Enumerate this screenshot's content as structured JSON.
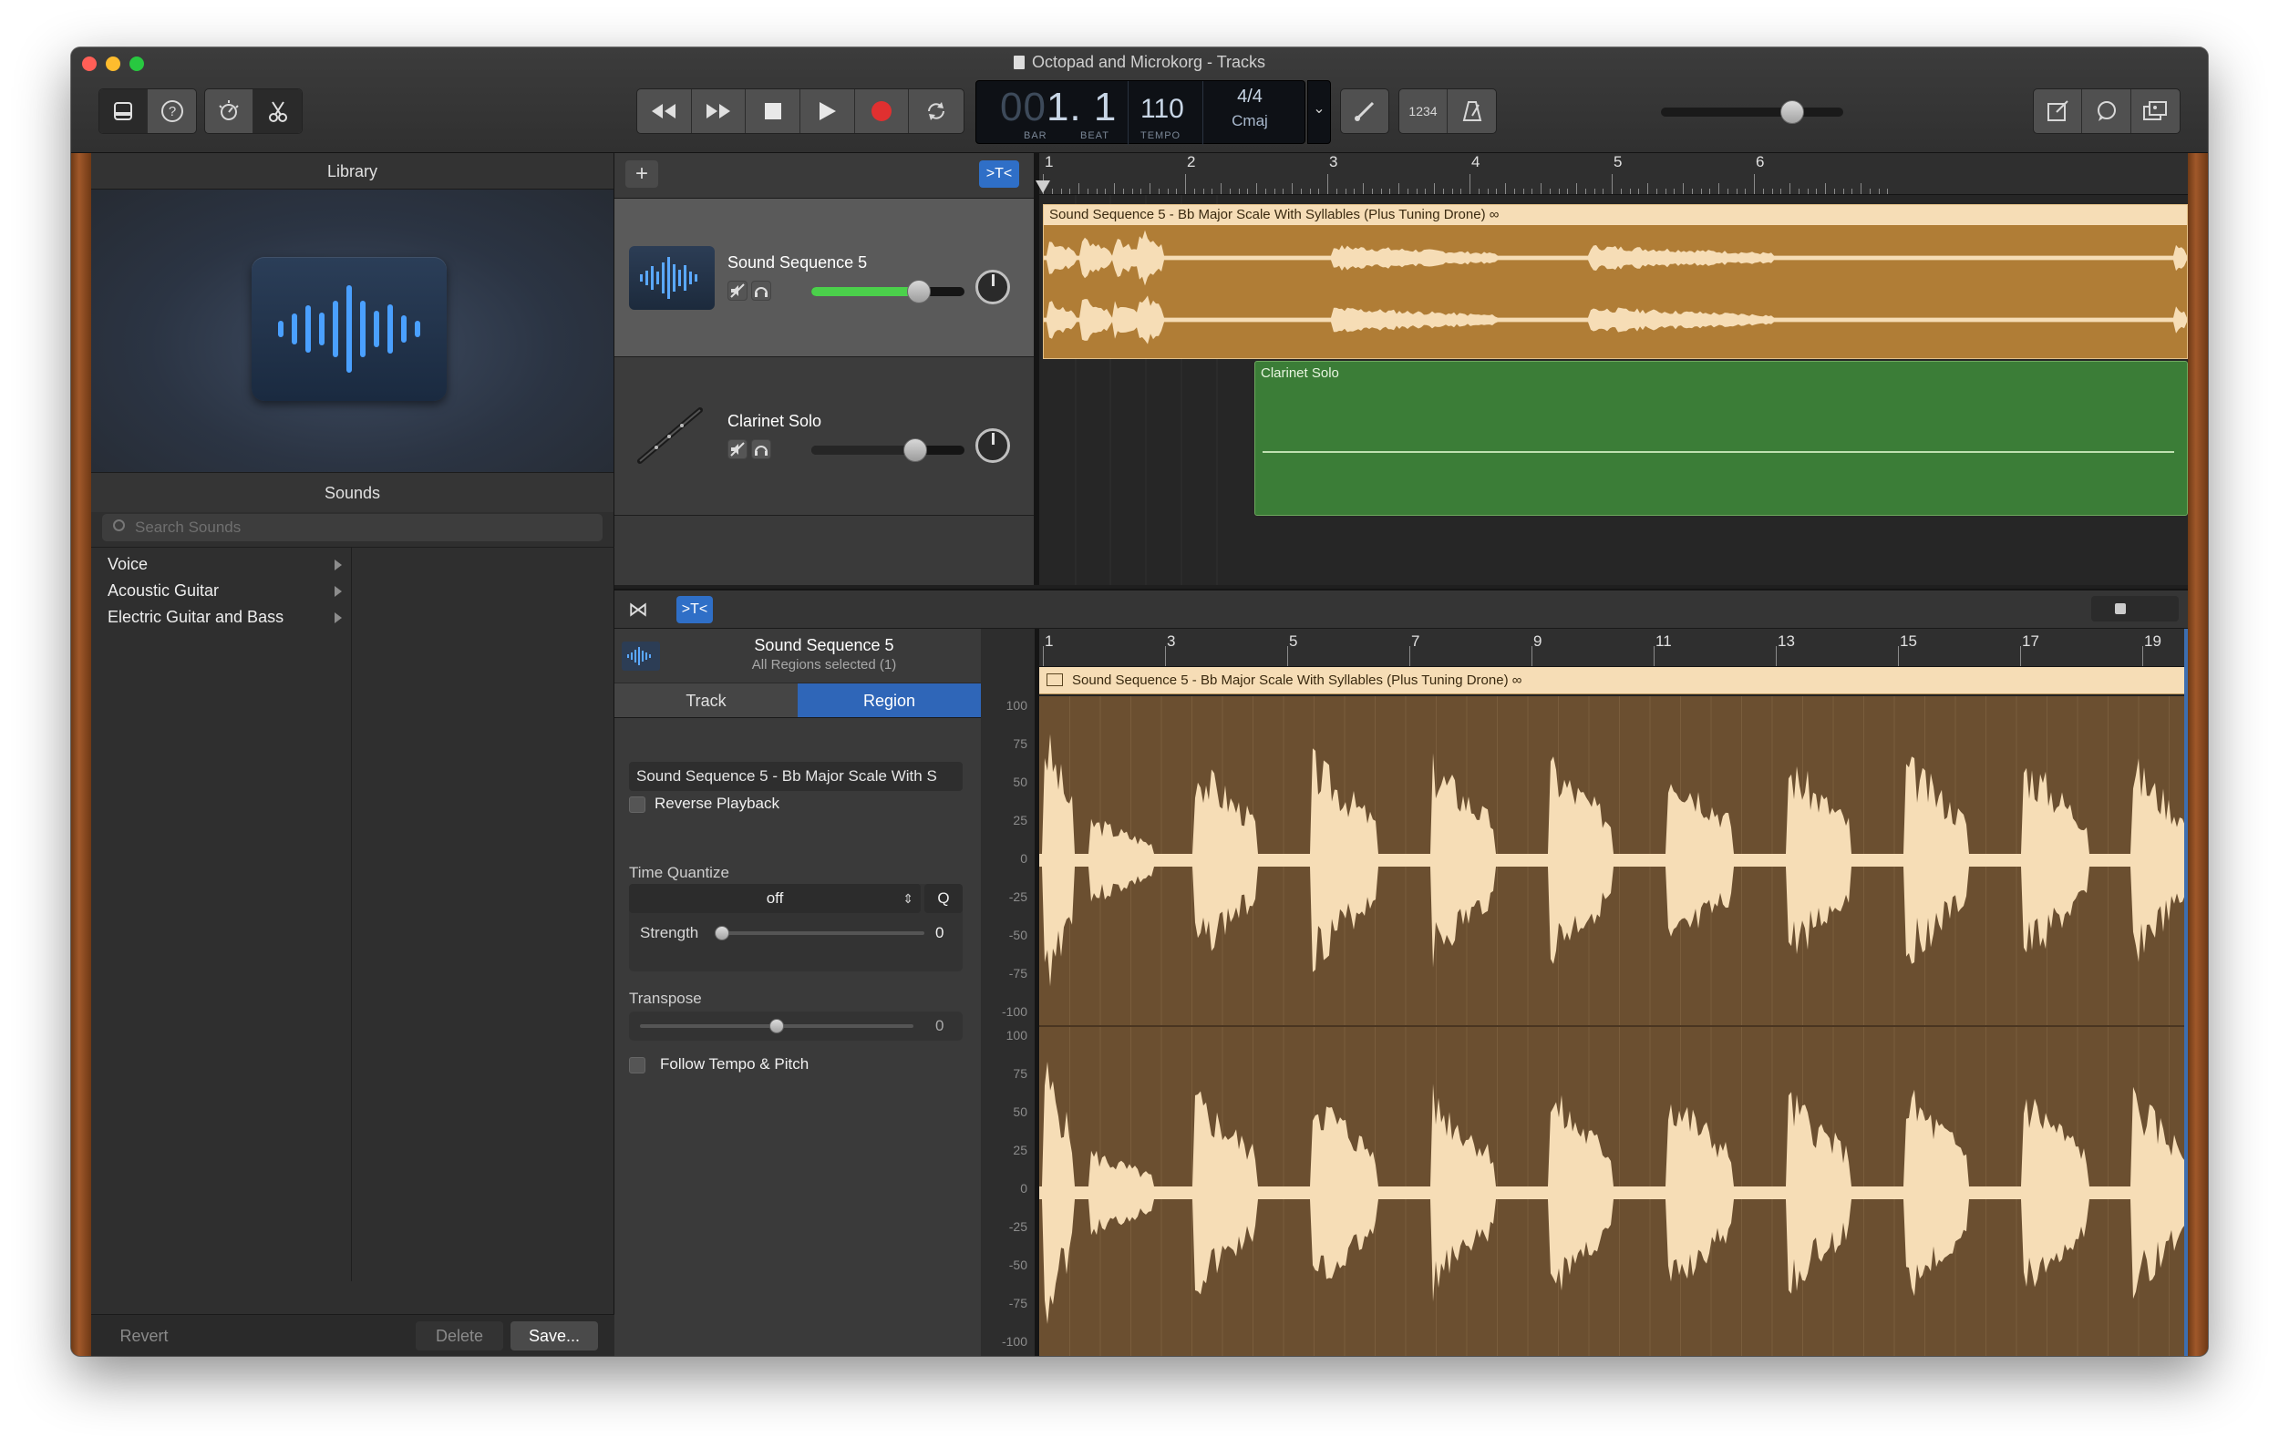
{
  "window": {
    "title": "Octopad and Microkorg - Tracks",
    "controls": [
      "close",
      "minimize",
      "zoom"
    ]
  },
  "toolbar": {
    "left_icons": [
      "library-icon",
      "help-icon",
      "smart-controls-icon",
      "editors-icon"
    ],
    "transport_icons": [
      "rewind-icon",
      "fast-forward-icon",
      "stop-icon",
      "play-icon",
      "record-icon",
      "cycle-icon"
    ],
    "lcd": {
      "bar_dim": "00",
      "position": "1. 1",
      "bar_label": "BAR",
      "beat_label": "BEAT",
      "tempo": "110",
      "tempo_label": "TEMPO",
      "signature": "4/4",
      "key": "Cmaj"
    },
    "right_icons": [
      "tuner-icon",
      "count-in-icon",
      "metronome-icon"
    ],
    "count_in_label": "1234",
    "master_volume": 0.72,
    "far_right_icons": [
      "notepad-icon",
      "loop-browser-icon",
      "media-browser-icon"
    ]
  },
  "library": {
    "header": "Library",
    "sounds_header": "Sounds",
    "search_placeholder": "Search Sounds",
    "categories": [
      "Voice",
      "Acoustic Guitar",
      "Electric Guitar and Bass"
    ],
    "footer": {
      "revert": "Revert",
      "delete": "Delete",
      "save": "Save..."
    }
  },
  "tracks": {
    "add_label": "+",
    "ruler_bars": [
      "1",
      "2",
      "3",
      "4",
      "5",
      "6"
    ],
    "items": [
      {
        "name": "Sound Sequence 5",
        "volume": 0.7,
        "region": "Sound Sequence 5 - Bb Major Scale With Syllables (Plus Tuning Drone)"
      },
      {
        "name": "Clarinet Solo",
        "volume": 0.68,
        "region": "Clarinet Solo"
      }
    ]
  },
  "editor": {
    "track_name": "Sound Sequence 5",
    "selection": "All Regions selected (1)",
    "tabs": [
      "Track",
      "Region"
    ],
    "active_tab": "Region",
    "region_name": "Sound Sequence 5 - Bb Major Scale With S",
    "reverse_label": "Reverse Playback",
    "time_quantize_label": "Time Quantize",
    "time_quantize_value": "off",
    "q_label": "Q",
    "strength_label": "Strength",
    "strength_value": "0",
    "transpose_label": "Transpose",
    "transpose_value": "0",
    "follow_label": "Follow Tempo & Pitch",
    "ruler_bars": [
      "1",
      "3",
      "5",
      "7",
      "9",
      "11",
      "13",
      "15",
      "17",
      "19"
    ],
    "region_label": "Sound Sequence 5 - Bb Major Scale With Syllables (Plus Tuning Drone)",
    "scale_top": [
      "100",
      "75",
      "50",
      "25",
      "0",
      "-25",
      "-50",
      "-75",
      "-100"
    ],
    "scale_bottom": [
      "100",
      "75",
      "50",
      "25",
      "0",
      "-25",
      "-50",
      "-75",
      "-100"
    ]
  },
  "colors": {
    "audio_region": "#b07d36",
    "audio_label": "#f6ddb6",
    "midi_region": "#3b7d37",
    "accent_blue": "#2f66b8",
    "record_red": "#e03030"
  }
}
